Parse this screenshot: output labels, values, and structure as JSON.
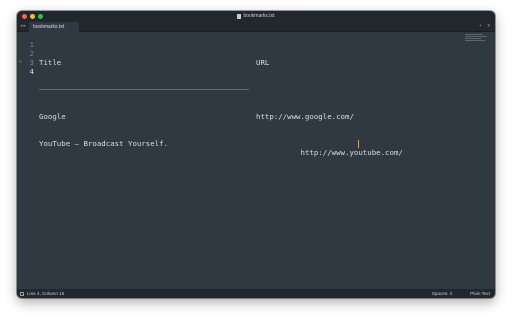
{
  "window": {
    "title": "bookmarks.txt"
  },
  "tabs": [
    {
      "label": "bookmarks.txt",
      "active": true
    }
  ],
  "tabbar": {
    "nav_arrows": "◂▸",
    "right_controls": "+ ▾"
  },
  "editor": {
    "lines": [
      {
        "number": "1",
        "col1": "Title",
        "col2": "URL",
        "rule": false
      },
      {
        "number": "2",
        "col1": "",
        "col2": "",
        "rule": true
      },
      {
        "number": "3",
        "col1": "Google",
        "col2": "http://www.google.com/",
        "rule": false
      },
      {
        "number": "4",
        "col1": "YouTube – Broadcast Yourself.",
        "col2": "http://www.youtube.com/",
        "rule": false,
        "current": true
      }
    ]
  },
  "statusbar": {
    "position": "Line 4, Column 15",
    "spaces": "Spaces: 4",
    "syntax": "Plain Text"
  },
  "colors": {
    "editor_bg": "#303841",
    "chrome_bg": "#22272d",
    "text": "#d8dee9",
    "line_number": "#76808b",
    "cursor": "#f0a040"
  },
  "icons": {
    "close": "close-icon",
    "minimize": "minimize-icon",
    "zoom": "zoom-icon",
    "file": "file-icon",
    "panel": "panel-toggle-icon"
  }
}
